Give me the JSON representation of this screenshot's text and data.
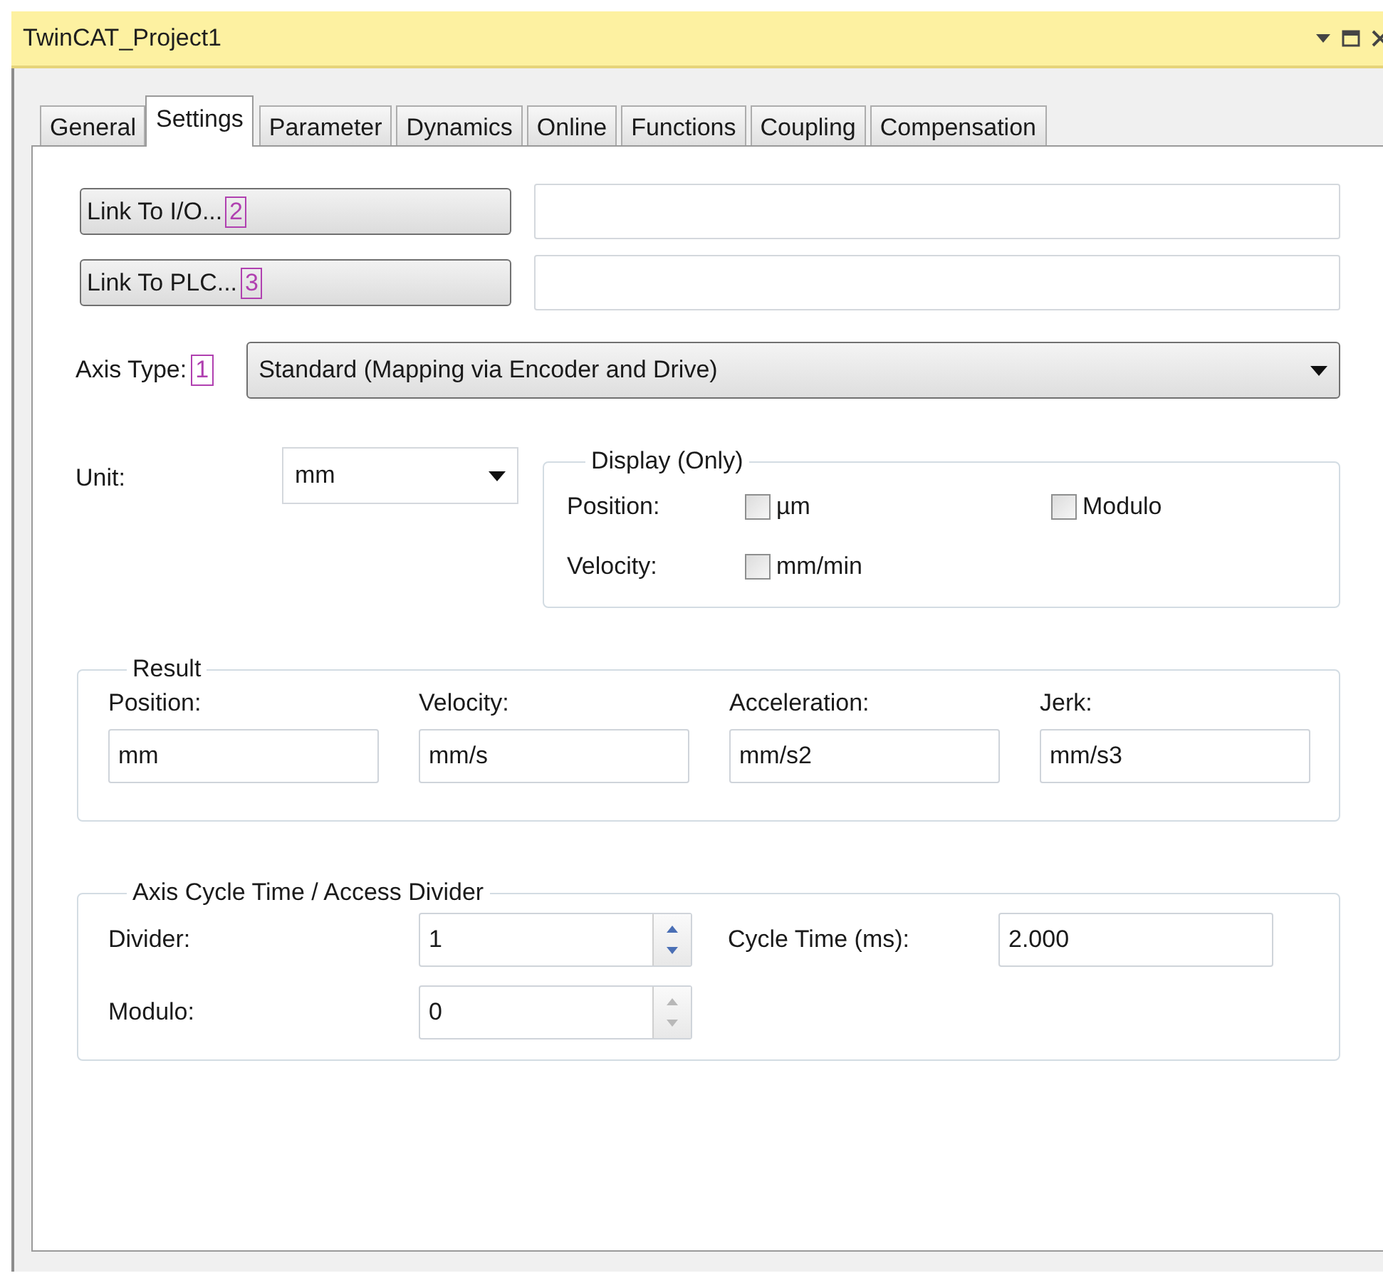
{
  "window": {
    "title": "TwinCAT_Project1"
  },
  "tabs": [
    {
      "label": "General",
      "selected": false
    },
    {
      "label": "Settings",
      "selected": true
    },
    {
      "label": "Parameter",
      "selected": false
    },
    {
      "label": "Dynamics",
      "selected": false
    },
    {
      "label": "Online",
      "selected": false
    },
    {
      "label": "Functions",
      "selected": false
    },
    {
      "label": "Coupling",
      "selected": false
    },
    {
      "label": "Compensation",
      "selected": false
    }
  ],
  "links": [
    {
      "label": "Link To I/O...",
      "badge": "2"
    },
    {
      "label": "Link To PLC...",
      "badge": "3"
    }
  ],
  "axis_type": {
    "label": "Axis Type:",
    "badge": "1",
    "value": "Standard (Mapping via Encoder and Drive)"
  },
  "unit": {
    "label": "Unit:",
    "value": "mm"
  },
  "display": {
    "title": "Display (Only)",
    "rows": [
      {
        "label": "Position:",
        "options": [
          {
            "label": "µm",
            "checked": false
          },
          {
            "label": "Modulo",
            "checked": false
          }
        ]
      },
      {
        "label": "Velocity:",
        "options": [
          {
            "label": "mm/min",
            "checked": false
          }
        ]
      }
    ]
  },
  "result": {
    "title": "Result",
    "fields": [
      {
        "label": "Position:",
        "value": "mm"
      },
      {
        "label": "Velocity:",
        "value": "mm/s"
      },
      {
        "label": "Acceleration:",
        "value": "mm/s2"
      },
      {
        "label": "Jerk:",
        "value": "mm/s3"
      }
    ]
  },
  "cycle": {
    "title": "Axis Cycle Time / Access Divider",
    "divider": {
      "label": "Divider:",
      "value": "1",
      "disabled": false
    },
    "modulo": {
      "label": "Modulo:",
      "value": "0",
      "disabled": true
    },
    "cycle_time": {
      "label": "Cycle Time (ms):",
      "value": "2.000"
    }
  }
}
